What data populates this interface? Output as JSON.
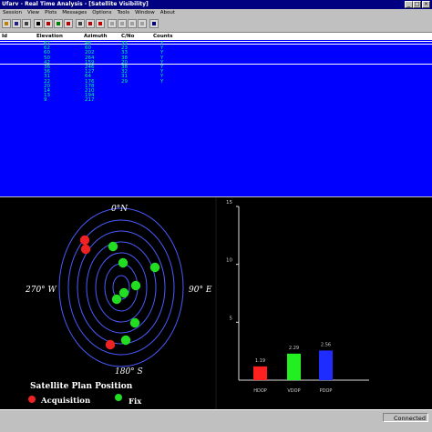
{
  "window": {
    "title": "Ufarv - Real Time Analysis - [Satellite Visibility]"
  },
  "menu": [
    "Session",
    "View",
    "Plots",
    "Messages",
    "Options",
    "Tools",
    "Window",
    "About"
  ],
  "toolbar": {
    "buttons": [
      {
        "icon": "open-icon",
        "color": "#c08000"
      },
      {
        "icon": "save-icon",
        "color": "#202080"
      },
      {
        "icon": "print-icon",
        "color": "#404040"
      },
      {
        "icon": "pointer-icon",
        "color": "#000000"
      },
      {
        "icon": "antenna-icon",
        "color": "#c00000"
      },
      {
        "icon": "satellite-icon",
        "color": "#008000"
      },
      {
        "icon": "record-icon",
        "color": "#c00000"
      },
      {
        "icon": "list-icon",
        "color": "#404040"
      },
      {
        "icon": "stop-icon",
        "color": "#c00000"
      },
      {
        "icon": "pin-icon",
        "color": "#c00000"
      },
      {
        "icon": "blank-icon",
        "color": "#a0a0a0"
      },
      {
        "icon": "blank-icon",
        "color": "#a0a0a0"
      },
      {
        "icon": "blank-icon",
        "color": "#a0a0a0"
      },
      {
        "icon": "blank-icon",
        "color": "#a0a0a0"
      },
      {
        "icon": "help-icon",
        "color": "#000080"
      }
    ]
  },
  "table": {
    "columns": [
      "Id",
      "Elevation",
      "Azimuth",
      "C/No",
      "Counts"
    ],
    "rows": [
      [
        "",
        "67",
        "48",
        "33",
        "Y"
      ],
      [
        "",
        "62",
        "60",
        "23",
        "Y"
      ],
      [
        "",
        "60",
        "202",
        "33",
        "Y"
      ],
      [
        "",
        "50",
        "264",
        "38",
        "Y"
      ],
      [
        "",
        "42",
        "159",
        "20",
        "Y"
      ],
      [
        "",
        "36",
        "246",
        "38",
        "Y"
      ],
      [
        "",
        "36",
        "127",
        "32",
        "Y"
      ],
      [
        "",
        "31",
        "64",
        "31",
        "Y"
      ],
      [
        "",
        "22",
        "176",
        "29",
        "Y"
      ],
      [
        "",
        "20",
        "178",
        "",
        ""
      ],
      [
        "",
        "14",
        "210",
        "",
        ""
      ],
      [
        "",
        "13",
        "194",
        "",
        ""
      ],
      [
        "",
        "9",
        "217",
        "",
        ""
      ]
    ]
  },
  "skyplot": {
    "north": "0°N",
    "south": "180° S",
    "west": "270° W",
    "east": "90° E",
    "legend_title": "Satellite Plan Position",
    "legend_acq": "Acquisition",
    "legend_fix": "Fix",
    "colors": {
      "ring": "#4a5aff",
      "fix": "#22dd22",
      "acq": "#ee2222",
      "text": "#ffffff"
    },
    "satellites": [
      {
        "label": "",
        "type": "acq"
      },
      {
        "label": "",
        "type": "acq"
      },
      {
        "label": "",
        "type": "fix"
      },
      {
        "label": "",
        "type": "fix"
      },
      {
        "label": "",
        "type": "fix"
      },
      {
        "label": "",
        "type": "fix"
      },
      {
        "label": "",
        "type": "fix"
      },
      {
        "label": "",
        "type": "fix"
      },
      {
        "label": "",
        "type": "fix"
      },
      {
        "label": "",
        "type": "fix"
      },
      {
        "label": "",
        "type": "acq"
      }
    ]
  },
  "chart_data": {
    "type": "bar",
    "categories": [
      "HDOP",
      "VDOP",
      "PDOP"
    ],
    "values": [
      1.19,
      2.29,
      2.56
    ],
    "value_labels": [
      "1.19",
      "2.29",
      "2.56"
    ],
    "colors": [
      "#ff2020",
      "#22ee22",
      "#1e2cff"
    ],
    "yticks": [
      "5",
      "10",
      "15"
    ],
    "ylim": [
      0,
      15
    ]
  },
  "status": {
    "text": "Connected"
  }
}
